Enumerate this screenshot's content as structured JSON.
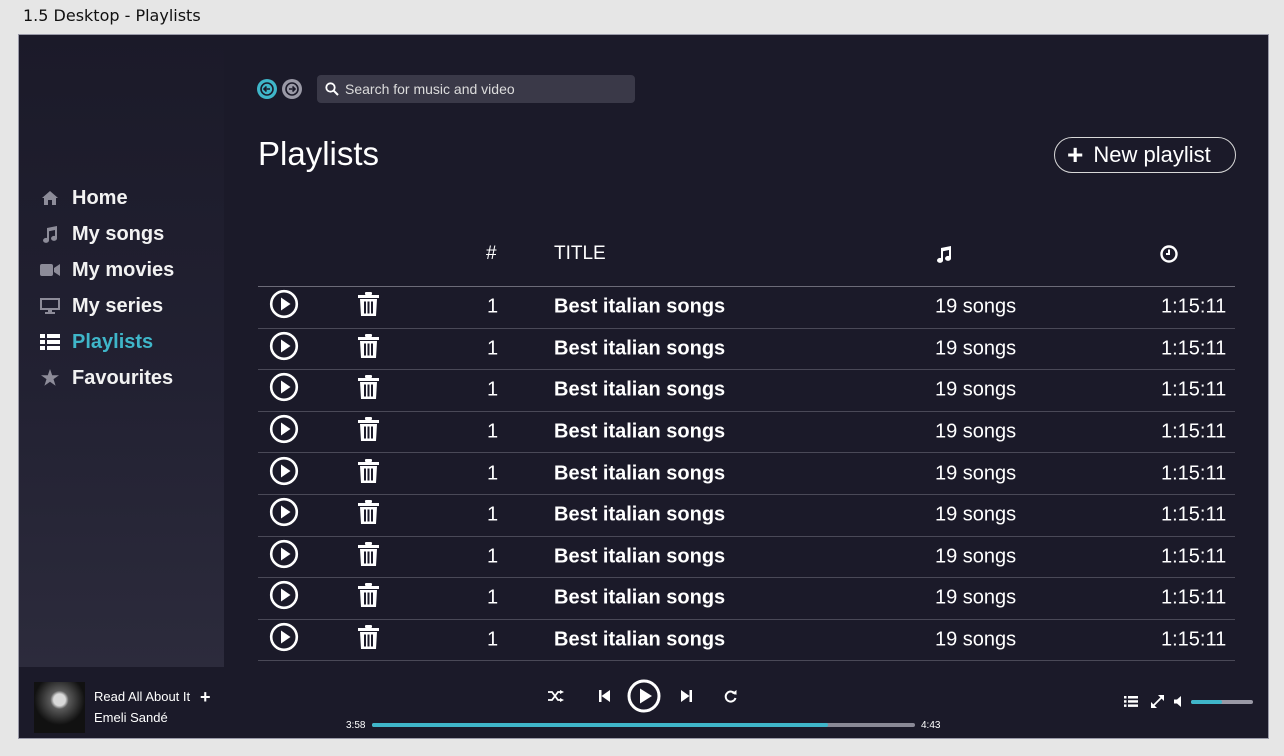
{
  "frame_caption": "1.5 Desktop - Playlists",
  "colors": {
    "accent": "#3fb6c9",
    "background": "#1b1a29",
    "text": "#ffffff"
  },
  "sidebar": {
    "items": [
      {
        "label": "Home",
        "icon": "home-icon",
        "active": false
      },
      {
        "label": "My songs",
        "icon": "music-note-icon",
        "active": false
      },
      {
        "label": "My movies",
        "icon": "video-camera-icon",
        "active": false
      },
      {
        "label": "My series",
        "icon": "monitor-icon",
        "active": false
      },
      {
        "label": "Playlists",
        "icon": "list-icon",
        "active": true
      },
      {
        "label": "Favourites",
        "icon": "star-icon",
        "active": false
      }
    ]
  },
  "search": {
    "placeholder": "Search for music and video"
  },
  "main": {
    "title": "Playlists",
    "new_playlist_label": "New playlist",
    "table": {
      "headers": {
        "number": "#",
        "title": "TITLE",
        "songs_icon": "music-note-icon",
        "duration_icon": "clock-icon"
      },
      "rows": [
        {
          "number": "1",
          "title": "Best italian songs",
          "songs": "19 songs",
          "duration": "1:15:11"
        },
        {
          "number": "1",
          "title": "Best italian songs",
          "songs": "19 songs",
          "duration": "1:15:11"
        },
        {
          "number": "1",
          "title": "Best italian songs",
          "songs": "19 songs",
          "duration": "1:15:11"
        },
        {
          "number": "1",
          "title": "Best italian songs",
          "songs": "19 songs",
          "duration": "1:15:11"
        },
        {
          "number": "1",
          "title": "Best italian songs",
          "songs": "19 songs",
          "duration": "1:15:11"
        },
        {
          "number": "1",
          "title": "Best italian songs",
          "songs": "19 songs",
          "duration": "1:15:11"
        },
        {
          "number": "1",
          "title": "Best italian songs",
          "songs": "19 songs",
          "duration": "1:15:11"
        },
        {
          "number": "1",
          "title": "Best italian songs",
          "songs": "19 songs",
          "duration": "1:15:11"
        },
        {
          "number": "1",
          "title": "Best italian songs",
          "songs": "19 songs",
          "duration": "1:15:11"
        }
      ]
    }
  },
  "player": {
    "track_title": "Read All About It",
    "track_artist": "Emeli Sandé",
    "current_time": "3:58",
    "total_time": "4:43",
    "progress": 0.84,
    "volume": 0.5
  }
}
